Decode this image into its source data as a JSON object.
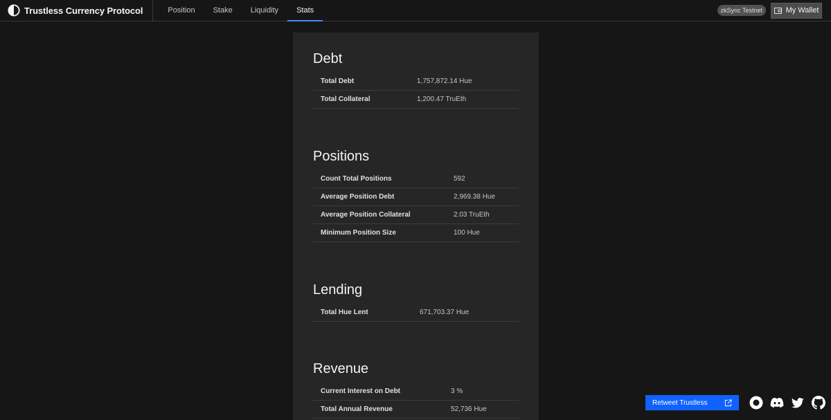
{
  "header": {
    "brand": "Trustless Currency Protocol",
    "nav": [
      {
        "label": "Position"
      },
      {
        "label": "Stake"
      },
      {
        "label": "Liquidity"
      },
      {
        "label": "Stats"
      }
    ],
    "active_tab": "Stats",
    "network": "zkSync Testnet",
    "wallet_label": "My Wallet"
  },
  "debt": {
    "title": "Debt",
    "rows": [
      {
        "label": "Total Debt",
        "value": "1,757,872.14 Hue"
      },
      {
        "label": "Total Collateral",
        "value": "1,200.47 TruEth"
      }
    ]
  },
  "positions": {
    "title": "Positions",
    "rows": [
      {
        "label": "Count Total Positions",
        "value": "592"
      },
      {
        "label": "Average Position Debt",
        "value": "2,969.38 Hue"
      },
      {
        "label": "Average Position Collateral",
        "value": "2.03 TruEth"
      },
      {
        "label": "Minimum Position Size",
        "value": "100 Hue"
      }
    ]
  },
  "lending": {
    "title": "Lending",
    "rows": [
      {
        "label": "Total Hue Lent",
        "value": "671,703.37 Hue"
      }
    ]
  },
  "revenue": {
    "title": "Revenue",
    "rows": [
      {
        "label": "Current Interest on Debt",
        "value": "3 %"
      },
      {
        "label": "Total Annual Revenue",
        "value": "52,736 Hue"
      }
    ]
  },
  "footer": {
    "retweet_label": "Retweet Trustless",
    "social_icons": [
      "github-circle-icon",
      "discord-icon",
      "twitter-icon",
      "github-icon"
    ]
  },
  "colors": {
    "background": "#161616",
    "panel": "#262626",
    "accent": "#0f62fe",
    "active_tab_underline": "#4589ff"
  }
}
